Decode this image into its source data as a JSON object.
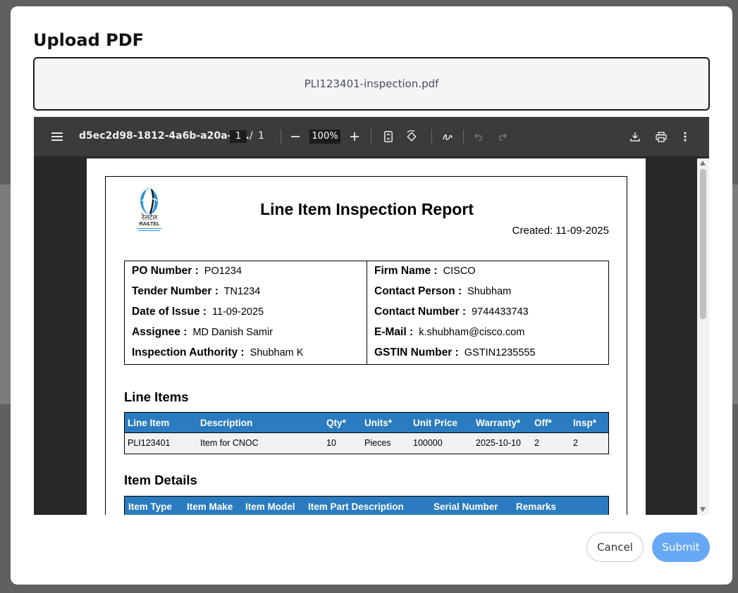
{
  "modal": {
    "title": "Upload PDF",
    "file_name": "PLI123401-inspection.pdf"
  },
  "viewer": {
    "doc_title": "d5ec2d98-1812-4a6b-a20a-e...",
    "current_page": "1",
    "page_separator": "/",
    "total_pages": "1",
    "zoom": "100%",
    "icons": [
      "menu-icon",
      "zoom-out-icon",
      "zoom-in-icon",
      "fit-page-icon",
      "rotate-icon",
      "draw-icon",
      "undo-icon",
      "redo-icon",
      "download-icon",
      "print-icon",
      "more-options-icon"
    ]
  },
  "report": {
    "logo_text": "RAILTEL",
    "logo_hindi": "रेलटेल",
    "title": "Line Item Inspection Report",
    "created": "Created: 11-09-2025",
    "left_info": [
      {
        "label": "PO Number :",
        "value": "PO1234"
      },
      {
        "label": "Tender Number :",
        "value": "TN1234"
      },
      {
        "label": "Date of Issue :",
        "value": "11-09-2025"
      },
      {
        "label": "Assignee :",
        "value": "MD Danish Samir"
      },
      {
        "label": "Inspection Authority :",
        "value": "Shubham K"
      }
    ],
    "right_info": [
      {
        "label": "Firm Name :",
        "value": "CISCO"
      },
      {
        "label": "Contact Person :",
        "value": "Shubham"
      },
      {
        "label": "Contact Number :",
        "value": "9744433743"
      },
      {
        "label": "E-Mail :",
        "value": "k.shubham@cisco.com"
      },
      {
        "label": "GSTIN Number :",
        "value": "GSTIN1235555"
      }
    ],
    "line_items_heading": "Line Items",
    "line_items_columns": [
      "Line Item",
      "Description",
      "Qty*",
      "Units*",
      "Unit Price",
      "Warranty*",
      "Off*",
      "Insp*"
    ],
    "line_items_rows": [
      [
        "PLI123401",
        "Item for CNOC",
        "10",
        "Pieces",
        "100000",
        "2025-10-10",
        "2",
        "2"
      ]
    ],
    "item_details_heading": "Item Details",
    "item_details_columns": [
      "Item Type",
      "Item Make",
      "Item Model",
      "Item Part Description",
      "Serial Number",
      "Remarks"
    ]
  },
  "buttons": {
    "cancel": "Cancel",
    "submit": "Submit"
  },
  "colors": {
    "table_header": "#2a7bbf",
    "submit_button": "#67a8f5",
    "viewer_toolbar": "#3b3b3b"
  }
}
